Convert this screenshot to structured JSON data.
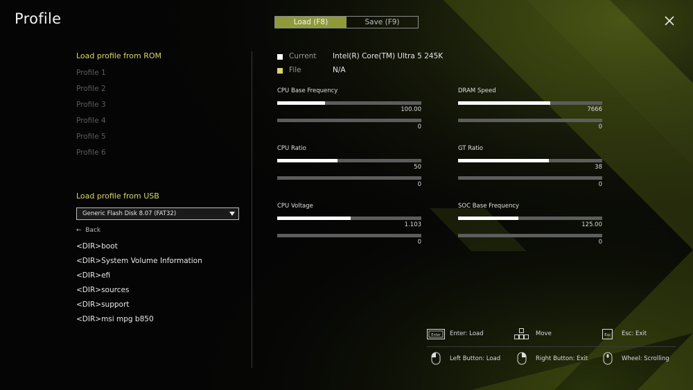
{
  "title": "Profile",
  "tabs": {
    "load": "Load (F8)",
    "save": "Save (F9)"
  },
  "rom": {
    "heading": "Load profile from ROM",
    "items": [
      "Profile 1",
      "Profile 2",
      "Profile 3",
      "Profile 4",
      "Profile 5",
      "Profile 6"
    ]
  },
  "usb": {
    "heading": "Load profile from USB",
    "selected": "Generic Flash Disk 8.07 (FAT32)",
    "back": "Back",
    "dirs": [
      "<DIR>boot",
      "<DIR>System Volume Information",
      "<DIR>efi",
      "<DIR>sources",
      "<DIR>support",
      "<DIR>msi mpg b850"
    ]
  },
  "current": {
    "label": "Current",
    "value": "Intel(R) Core(TM) Ultra 5 245K",
    "color": "#ffffff"
  },
  "file": {
    "label": "File",
    "value": "N/A",
    "color": "#d9d86a"
  },
  "metrics": [
    {
      "label": "CPU Base Frequency",
      "current": "100.00",
      "current_fill": 0.33,
      "file": "0",
      "file_fill": 0
    },
    {
      "label": "DRAM Speed",
      "current": "7666",
      "current_fill": 0.64,
      "file": "0",
      "file_fill": 0
    },
    {
      "label": "CPU Ratio",
      "current": "50",
      "current_fill": 0.42,
      "file": "0",
      "file_fill": 0
    },
    {
      "label": "GT Ratio",
      "current": "38",
      "current_fill": 0.63,
      "file": "0",
      "file_fill": 0
    },
    {
      "label": "CPU Voltage",
      "current": "1.103",
      "current_fill": 0.51,
      "file": "0",
      "file_fill": 0
    },
    {
      "label": "SOC Base Frequency",
      "current": "125.00",
      "current_fill": 0.42,
      "file": "0",
      "file_fill": 0
    }
  ],
  "help": {
    "enter": "Enter: Load",
    "move": "Move",
    "esc": "Esc: Exit",
    "left": "Left Button: Load",
    "right": "Right Button: Exit",
    "wheel": "Wheel: Scrolling",
    "enter_key_text": "Enter",
    "esc_key_text": "Esc"
  },
  "colors": {
    "accent": "#d9d86a",
    "tab_active": "#8e9a3a",
    "bg_art": "#8fa02a"
  }
}
